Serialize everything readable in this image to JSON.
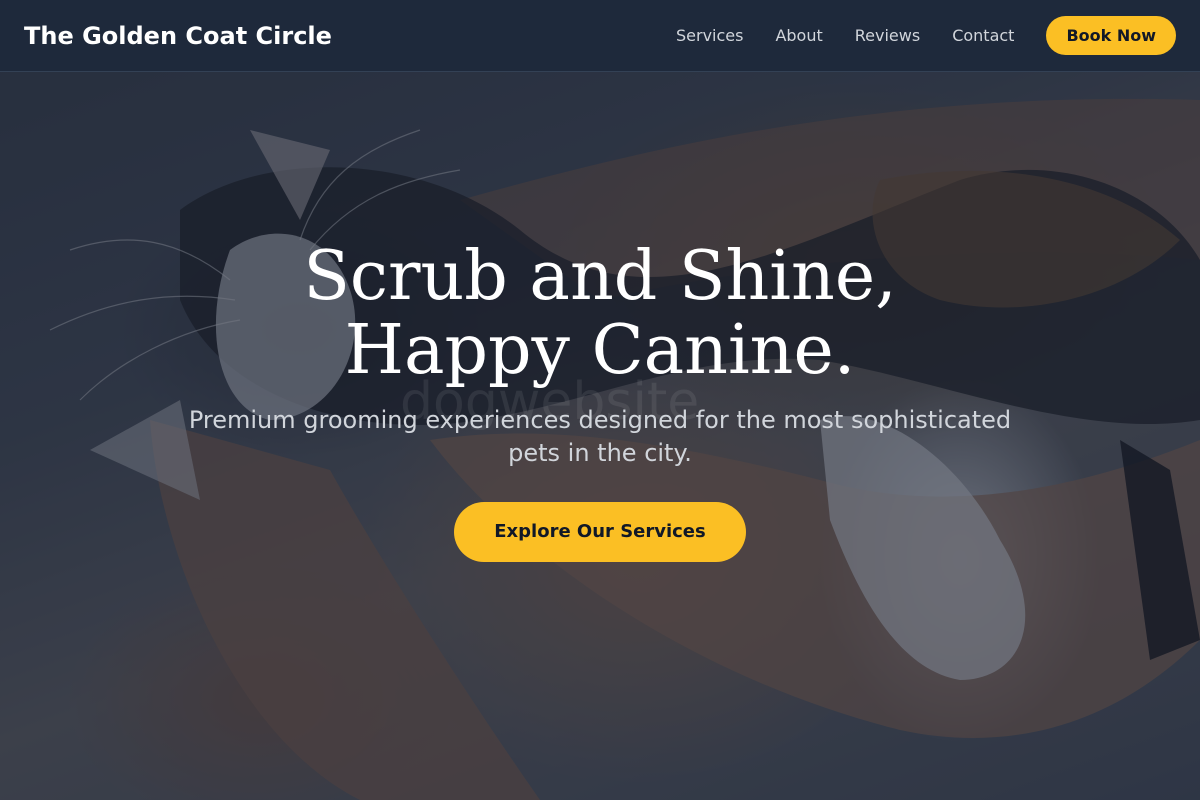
{
  "nav": {
    "brand": "The Golden Coat Circle",
    "links": [
      "Services",
      "About",
      "Reviews",
      "Contact"
    ],
    "book_label": "Book Now"
  },
  "hero": {
    "title": "Scrub and Shine, Happy Canine.",
    "subtitle": "Premium grooming experiences designed for the most sophisticated pets in the city.",
    "cta_label": "Explore Our Services",
    "watermark": "dogwebsite",
    "image_subject": "cat-held-in-arms-photo"
  },
  "colors": {
    "nav_bg": "#1e293b",
    "accent": "#fbbf24",
    "text_light": "#ffffff",
    "text_muted": "#d1d5db"
  }
}
